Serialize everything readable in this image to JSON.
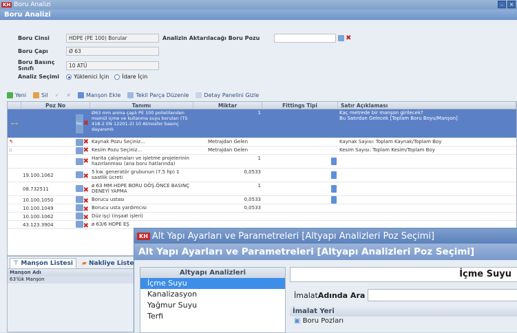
{
  "window": {
    "title": "Boru Analizi",
    "header": "Boru Analizi"
  },
  "form": {
    "boru_cinsi_label": "Boru Cinsi",
    "boru_cinsi_value": "HDPE (PE 100) Borular",
    "boru_capi_label": "Boru Çapı",
    "boru_capi_value": "Ø 63",
    "basinc_label": "Boru Basınç Sınıfı",
    "basinc_value": "10 ATÜ",
    "analiz_secimi_label": "Analiz Seçimi",
    "option_yuklenici": "Yüklenici İçin",
    "option_idare": "İdare İçin",
    "aktarilacak_label": "Analizin Aktarılacağı Boru Pozu"
  },
  "toolbar": {
    "yeni": "Yeni",
    "sil": "Sil",
    "manson_ekle": "Manşon Ekle",
    "tekil_parca": "Tekil Parça Düzenle",
    "detay_paneli": "Detay Panelini Gizle"
  },
  "grid": {
    "columns": [
      "Poz No",
      "Tanımı",
      "Miktar",
      "Fittings Tipi",
      "Satır Açıklaması"
    ],
    "rows": [
      {
        "poz": "",
        "tanim": "Ø63 mm anma çaplı PE 100 polietilenden mamül içme ve kullanma suyu boruları (TS 418-2 EN 12201-2) 10 Atmosfer basınç dayanımlı",
        "miktar": "1",
        "aciklama1": "Kaç metrede bir manşon girilecek?",
        "aciklama2": "Bu Satırdan Gelecek [Toplam Boru Boyu/Manşon]"
      },
      {
        "poz": "",
        "tanim": "Kaynak Pozu Seçiniz...",
        "miktar": "Metrajdan Gelen",
        "aciklama1": "Kaynak Sayısı: Toplam Kaynak/Toplam Boy"
      },
      {
        "poz": "",
        "tanim": "Kesim Pozu Seçiniz...",
        "miktar": "Metrajdan Gelen",
        "aciklama1": "Kesim Sayısı: Toplam Kesim/Toplam Boy"
      },
      {
        "poz": "",
        "tanim": "Harita çalışmaları ve işletme projelerinin hazırlanması (ana boru hatlarında)",
        "miktar": "1"
      },
      {
        "poz": "19.100.1062",
        "tanim": "5 kw. generatör grubunun (7.5 hp) 1 saatlik ücreti",
        "miktar": "0,0533"
      },
      {
        "poz": "08.732511",
        "tanim": "ø 63 MM.HDPE BORU DÖŞ.ÖNCE BASINÇ DENEYİ YAPMA",
        "miktar": "1"
      },
      {
        "poz": "10.100.1050",
        "tanim": "Borucu ustası",
        "miktar": "0,0533"
      },
      {
        "poz": "10.100.1049",
        "tanim": "Borucu usta yardımcısı",
        "miktar": "0,0533"
      },
      {
        "poz": "10.100.1062",
        "tanim": "Düz işçi (inşaat işleri)",
        "miktar": ""
      },
      {
        "poz": "43.123.3904",
        "tanim": "ø 63/6 HDPE EŞ",
        "miktar": ""
      }
    ]
  },
  "bottom_tabs": {
    "tab1": "Manşon Listesi",
    "tab2": "Nakliye Listesi",
    "col_header": "Manşon Adı",
    "row1": "63'lük Manşon"
  },
  "dialog": {
    "title": "Alt Yapı Ayarları ve Parametreleri [Altyapı Analizleri Poz Seçimi]",
    "header": "Alt Yapı Ayarları ve Parametreleri [Altyapı Analizleri Poz Seçimi]",
    "left_header": "Altyapı Analizleri",
    "items": [
      "İçme Suyu",
      "Kanalizasyon",
      "Yağmur Suyu",
      "Terfi"
    ],
    "right_title": "İçme Suyu",
    "search_label_prefix": "İmalat ",
    "search_label_bold": "Adında Ara",
    "imalat_yeri": "İmalat Yeri",
    "boru_pozlari": "Boru Pozları"
  }
}
